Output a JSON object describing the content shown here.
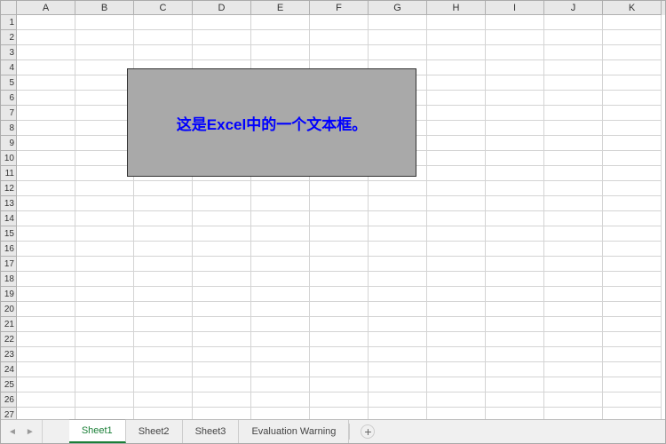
{
  "columns": [
    "A",
    "B",
    "C",
    "D",
    "E",
    "F",
    "G",
    "H",
    "I",
    "J",
    "K"
  ],
  "first_row": 1,
  "last_row": 27,
  "textbox": {
    "content": "这是Excel中的一个文本框。"
  },
  "tabs": {
    "items": [
      {
        "label": "Sheet1",
        "active": true
      },
      {
        "label": "Sheet2",
        "active": false
      },
      {
        "label": "Sheet3",
        "active": false
      },
      {
        "label": "Evaluation Warning",
        "active": false
      }
    ],
    "nav_prev": "◄",
    "nav_next": "►",
    "add_label": "+"
  }
}
